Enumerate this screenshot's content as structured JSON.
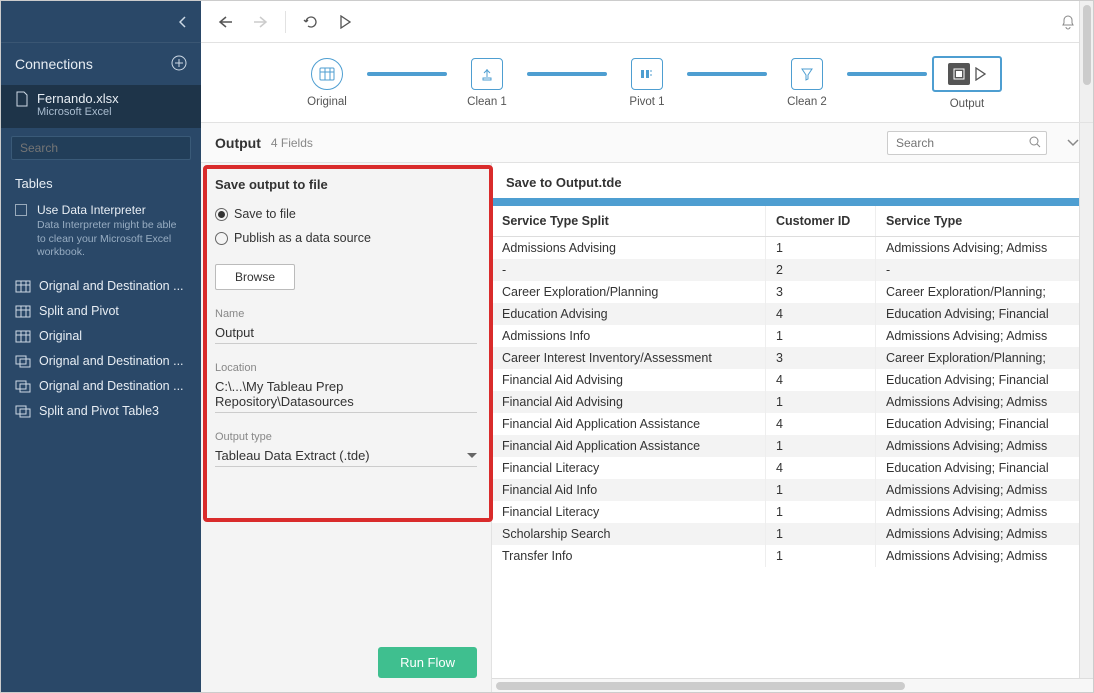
{
  "sidebar": {
    "connections_label": "Connections",
    "file": {
      "name": "Fernando.xlsx",
      "type": "Microsoft Excel"
    },
    "search_placeholder": "Search",
    "tables_label": "Tables",
    "interpreter": {
      "title": "Use Data Interpreter",
      "sub": "Data Interpreter might be able to clean your Microsoft Excel workbook."
    },
    "items": [
      "Orignal and Destination ...",
      "Split and Pivot",
      "Original",
      "Orignal and Destination ...",
      "Orignal and Destination ...",
      "Split and Pivot Table3"
    ]
  },
  "flow": {
    "steps": [
      "Original",
      "Clean 1",
      "Pivot 1",
      "Clean 2",
      "Output"
    ]
  },
  "header": {
    "title": "Output",
    "fields": "4 Fields",
    "search_placeholder": "Search"
  },
  "save_panel": {
    "title": "Save output to file",
    "opt1": "Save to file",
    "opt2": "Publish as a data source",
    "browse": "Browse",
    "name_label": "Name",
    "name_value": "Output",
    "location_label": "Location",
    "location_value": "C:\\...\\My Tableau Prep Repository\\Datasources",
    "type_label": "Output type",
    "type_value": "Tableau Data Extract (.tde)",
    "run": "Run Flow"
  },
  "preview": {
    "title": "Save to Output.tde",
    "columns": [
      "Service Type Split",
      "Customer ID",
      "Service Type"
    ],
    "rows": [
      [
        "Admissions Advising",
        "1",
        "Admissions Advising; Admiss"
      ],
      [
        "-",
        "2",
        "-"
      ],
      [
        "Career Exploration/Planning",
        "3",
        "Career Exploration/Planning;"
      ],
      [
        "Education Advising",
        "4",
        "Education Advising; Financial"
      ],
      [
        "Admissions Info",
        "1",
        "Admissions Advising; Admiss"
      ],
      [
        "Career Interest Inventory/Assessment",
        "3",
        "Career Exploration/Planning;"
      ],
      [
        "Financial Aid Advising",
        "4",
        "Education Advising; Financial"
      ],
      [
        "Financial Aid Advising",
        "1",
        "Admissions Advising; Admiss"
      ],
      [
        "Financial Aid Application Assistance",
        "4",
        "Education Advising; Financial"
      ],
      [
        "Financial Aid Application Assistance",
        "1",
        "Admissions Advising; Admiss"
      ],
      [
        "Financial Literacy",
        "4",
        "Education Advising; Financial"
      ],
      [
        "Financial Aid Info",
        "1",
        "Admissions Advising; Admiss"
      ],
      [
        "Financial Literacy",
        "1",
        "Admissions Advising; Admiss"
      ],
      [
        "Scholarship Search",
        "1",
        "Admissions Advising; Admiss"
      ],
      [
        "Transfer Info",
        "1",
        "Admissions Advising; Admiss"
      ]
    ]
  }
}
